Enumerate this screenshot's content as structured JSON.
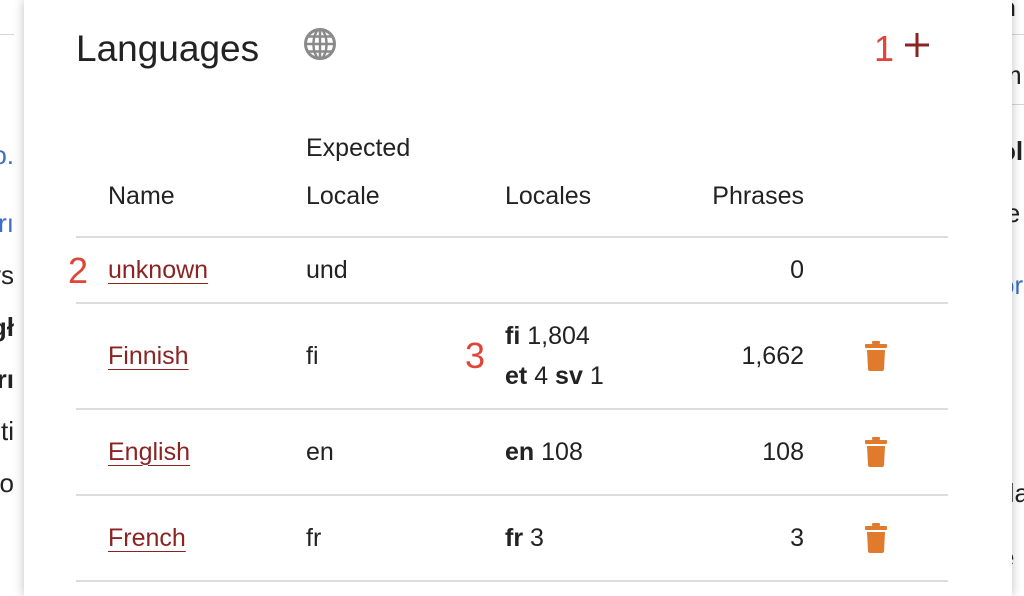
{
  "background": {
    "left_fragments": [
      "o.",
      "rı",
      "rs",
      "gł",
      "rı",
      "ti",
      "o"
    ],
    "right_fragments": [
      "n",
      "m",
      "ol",
      "le",
      "or",
      "l",
      "da",
      "e"
    ]
  },
  "panel": {
    "title": "Languages",
    "globe_icon": "globe-icon",
    "add_icon": "plus-icon",
    "markers": [
      "1",
      "2",
      "3"
    ]
  },
  "table": {
    "headers": {
      "name": "Name",
      "expected_locale_line1": "Expected",
      "expected_locale_line2": "Locale",
      "locales": "Locales",
      "phrases": "Phrases"
    },
    "rows": [
      {
        "name": "unknown",
        "expected": "und",
        "locales": [],
        "phrases": "0",
        "deletable": false
      },
      {
        "name": "Finnish",
        "expected": "fi",
        "locales": [
          [
            {
              "code": "fi",
              "count": "1,804"
            }
          ],
          [
            {
              "code": "et",
              "count": "4"
            },
            {
              "code": "sv",
              "count": "1"
            }
          ]
        ],
        "phrases": "1,662",
        "deletable": true
      },
      {
        "name": "English",
        "expected": "en",
        "locales": [
          [
            {
              "code": "en",
              "count": "108"
            }
          ]
        ],
        "phrases": "108",
        "deletable": true
      },
      {
        "name": "French",
        "expected": "fr",
        "locales": [
          [
            {
              "code": "fr",
              "count": "3"
            }
          ]
        ],
        "phrases": "3",
        "deletable": true
      }
    ]
  },
  "colors": {
    "link": "#8b2323",
    "add_icon": "#8b2323",
    "trash_icon": "#e07a2c",
    "marker": "#e0453a"
  }
}
